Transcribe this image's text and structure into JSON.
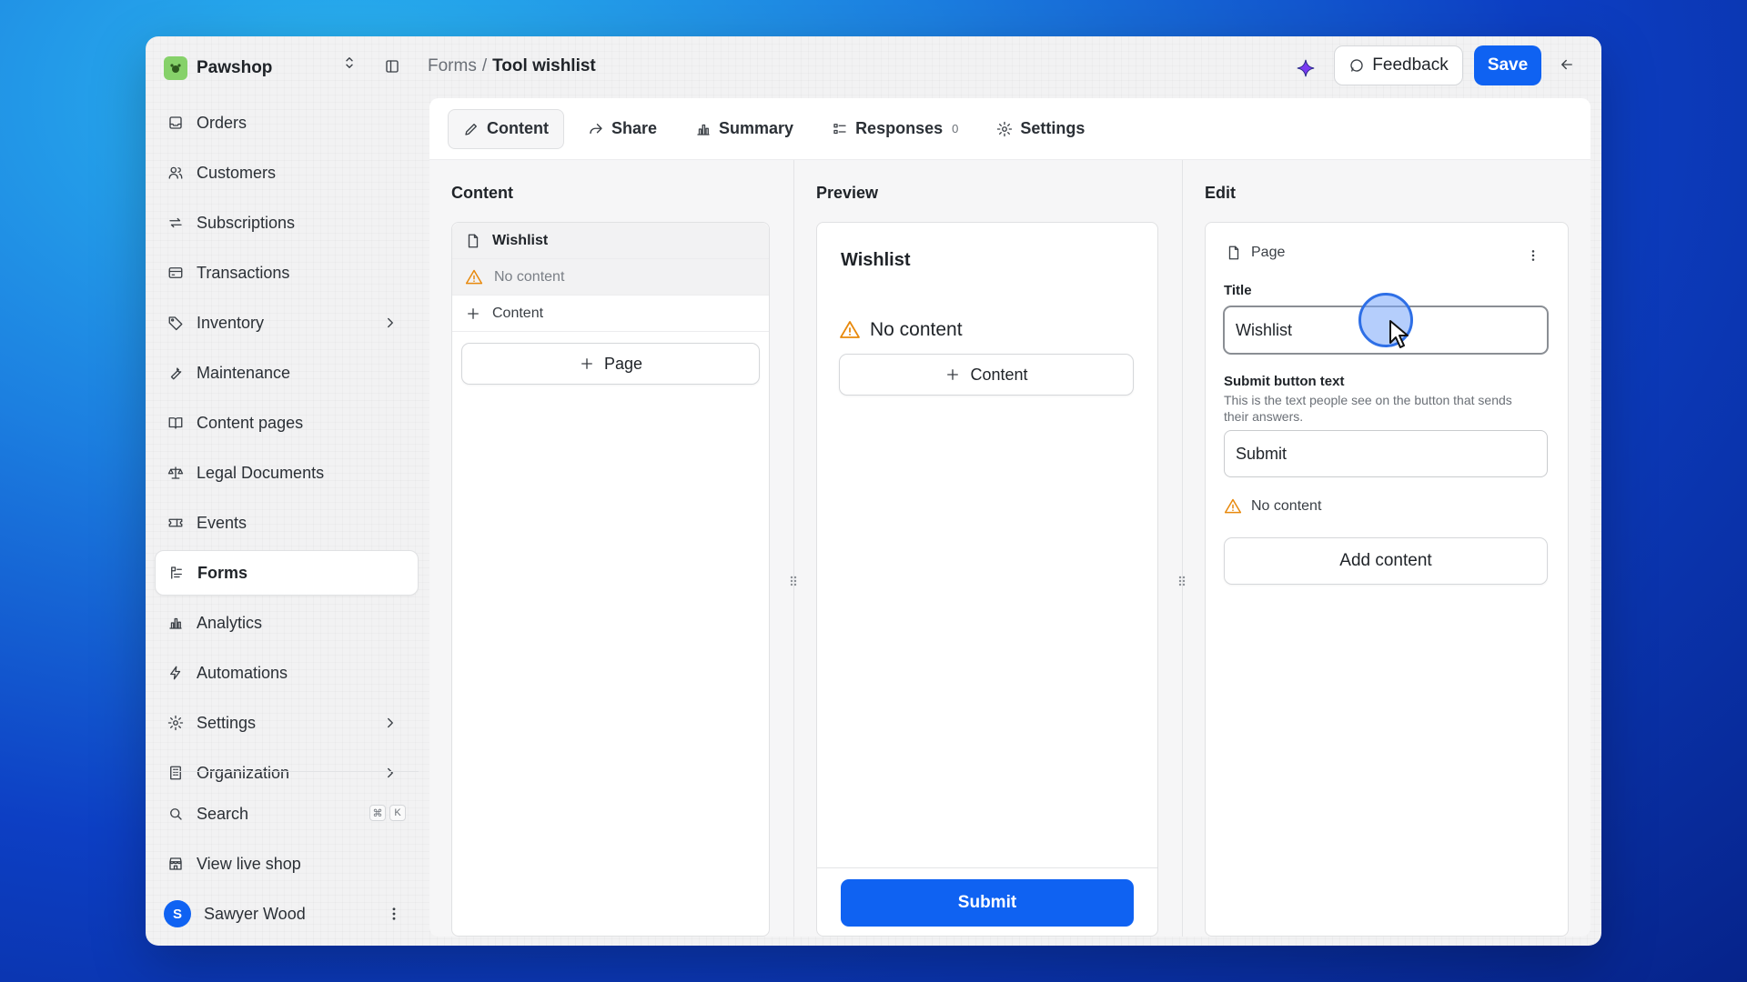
{
  "app": {
    "name": "Pawshop",
    "brand_color": "#86d16a"
  },
  "breadcrumb": {
    "parent": "Forms",
    "separator": "/",
    "current": "Tool wishlist"
  },
  "header": {
    "feedback_label": "Feedback",
    "save_label": "Save",
    "accent": "#0f62f2"
  },
  "sidebar": {
    "items": [
      {
        "label": "Orders",
        "icon": "inbox-icon"
      },
      {
        "label": "Customers",
        "icon": "users-icon"
      },
      {
        "label": "Subscriptions",
        "icon": "repeat-icon"
      },
      {
        "label": "Transactions",
        "icon": "credit-card-icon"
      },
      {
        "label": "Inventory",
        "icon": "tag-icon",
        "expandable": true
      },
      {
        "label": "Maintenance",
        "icon": "wrench-icon"
      },
      {
        "label": "Content pages",
        "icon": "book-icon"
      },
      {
        "label": "Legal Documents",
        "icon": "scale-icon"
      },
      {
        "label": "Events",
        "icon": "ticket-icon"
      },
      {
        "label": "Forms",
        "icon": "form-icon",
        "active": true
      },
      {
        "label": "Analytics",
        "icon": "bar-chart-icon"
      },
      {
        "label": "Automations",
        "icon": "bolt-icon"
      },
      {
        "label": "Settings",
        "icon": "gear-icon",
        "expandable": true
      },
      {
        "label": "Organization",
        "icon": "building-icon",
        "expandable": true
      }
    ],
    "search_label": "Search",
    "search_shortcut": [
      "⌘",
      "K"
    ],
    "view_shop_label": "View live shop",
    "user": {
      "initial": "S",
      "name": "Sawyer Wood"
    }
  },
  "tabs": [
    {
      "label": "Content",
      "active": true
    },
    {
      "label": "Share"
    },
    {
      "label": "Summary"
    },
    {
      "label": "Responses",
      "count": "0"
    },
    {
      "label": "Settings"
    }
  ],
  "content_panel": {
    "title": "Content",
    "page_item": "Wishlist",
    "warning_item": "No content",
    "add_content_item": "Content",
    "add_page_button": "Page"
  },
  "preview_panel": {
    "title": "Preview",
    "page_title": "Wishlist",
    "warning": "No content",
    "add_content_button": "Content",
    "submit_button": "Submit"
  },
  "edit_panel": {
    "title": "Edit",
    "type_label": "Page",
    "title_label": "Title",
    "title_value": "Wishlist",
    "submit_label": "Submit button text",
    "submit_help": "This is the text people see on the button that sends their answers.",
    "submit_value": "Submit",
    "warning": "No content",
    "add_content_button": "Add content"
  }
}
